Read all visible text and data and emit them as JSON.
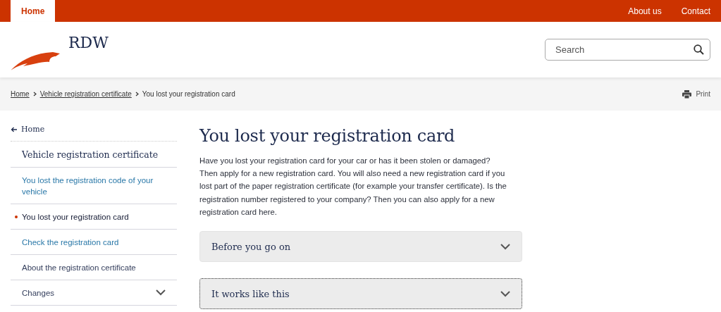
{
  "top_nav": {
    "tabs": [
      {
        "label": "Home",
        "selected": true
      }
    ],
    "links": [
      "About us",
      "Contact"
    ]
  },
  "header": {
    "logo_text": "RDW",
    "search": {
      "placeholder": "Search"
    }
  },
  "breadcrumb": {
    "items": [
      "Home",
      "Vehicle registration certificate"
    ],
    "current": "You lost your registration card",
    "print": "Print"
  },
  "sidebar": {
    "back": "Home",
    "title": "Vehicle registration certificate",
    "items": [
      {
        "label": "You lost the registration code of your vehicle",
        "kind": "link",
        "selected": false
      },
      {
        "label": "You lost your registration card",
        "kind": "link",
        "selected": true
      },
      {
        "label": "Check the registration card",
        "kind": "link",
        "selected": false
      },
      {
        "label": "About the registration certificate",
        "kind": "plain",
        "selected": false
      },
      {
        "label": "Changes",
        "kind": "group",
        "selected": false
      }
    ]
  },
  "main": {
    "title": "You lost your registration card",
    "intro": "Have you lost your registration card for your car or has it been stolen or damaged? Then apply for a new registration card. You will also need a new registration card if you lost part of the paper registration certificate (for example your transfer certificate). Is the registration number registered to your company? Then you can also apply for a new registration card here.",
    "accordions": [
      {
        "label": "Before you go on",
        "expanded": false,
        "focused": false
      },
      {
        "label": "It works like this",
        "expanded": false,
        "focused": true
      }
    ]
  }
}
